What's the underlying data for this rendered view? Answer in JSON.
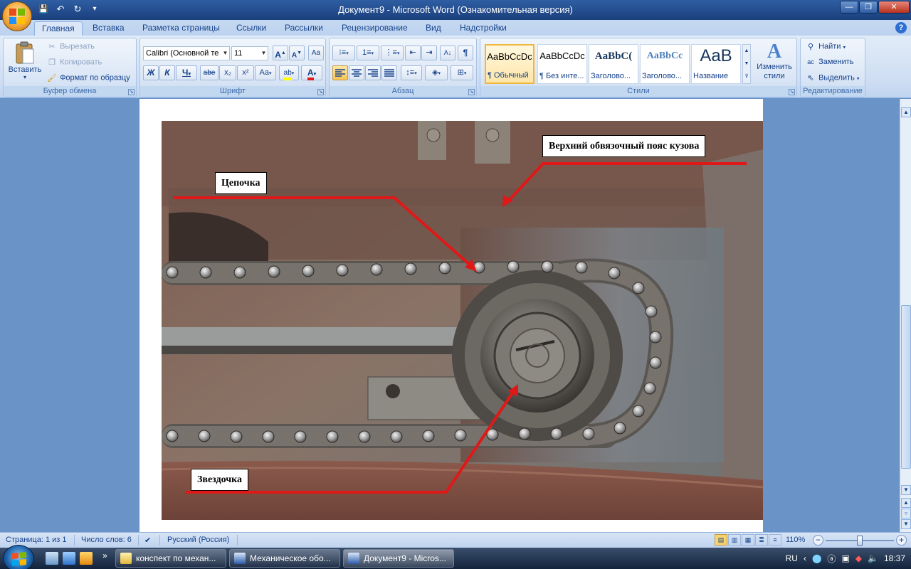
{
  "window": {
    "title": "Документ9 - Microsoft Word (Ознакомительная версия)",
    "controls": {
      "minimize": "—",
      "maximize": "❐",
      "close": "✕"
    }
  },
  "qat": {
    "save": "💾",
    "undo": "↶",
    "redo": "↻",
    "more": "▾"
  },
  "tabs": [
    "Главная",
    "Вставка",
    "Разметка страницы",
    "Ссылки",
    "Рассылки",
    "Рецензирование",
    "Вид",
    "Надстройки"
  ],
  "help": "?",
  "ribbon": {
    "clipboard": {
      "paste": "Вставить",
      "cut": "Вырезать",
      "copy": "Копировать",
      "format_painter": "Формат по образцу",
      "label": "Буфер обмена"
    },
    "font": {
      "family": "Calibri (Основной те",
      "size": "11",
      "grow": "A",
      "shrink": "A",
      "clear": "Aa",
      "bold": "Ж",
      "italic": "К",
      "underline": "Ч",
      "strike": "abe",
      "subscript": "x₂",
      "superscript": "x²",
      "case": "Aa",
      "highlight": "ab",
      "color": "A",
      "label": "Шрифт"
    },
    "paragraph": {
      "show_marks": "¶",
      "sort": "A↓",
      "label": "Абзац"
    },
    "styles": {
      "items": [
        {
          "sample": "AaBbCcDc",
          "name": "¶ Обычный"
        },
        {
          "sample": "AaBbCcDc",
          "name": "¶ Без инте..."
        },
        {
          "sample": "AaBbC(",
          "name": "Заголово..."
        },
        {
          "sample": "AaBbCc",
          "name": "Заголово..."
        },
        {
          "sample": "AaB",
          "name": "Название"
        }
      ],
      "change": "Изменить стили",
      "label": "Стили"
    },
    "editing": {
      "find": "Найти",
      "replace": "Заменить",
      "select": "Выделить",
      "label": "Редактирование"
    }
  },
  "document": {
    "callouts": {
      "top_belt": "Верхний обвязочный пояс кузова",
      "chain": "Цепочка",
      "sprocket": "Звездочка"
    },
    "colors": {
      "arrow": "#e01818"
    }
  },
  "statusbar": {
    "page": "Страница: 1 из 1",
    "words": "Число слов: 6",
    "language": "Русский (Россия)",
    "zoom": "110%",
    "zoom_minus": "−",
    "zoom_plus": "+"
  },
  "taskbar": {
    "tasks": [
      {
        "label": "конспект по механ..."
      },
      {
        "label": "Механическое обо..."
      },
      {
        "label": "Документ9 - Micros..."
      }
    ],
    "more": "»",
    "lang": "RU",
    "time": "18:37"
  }
}
